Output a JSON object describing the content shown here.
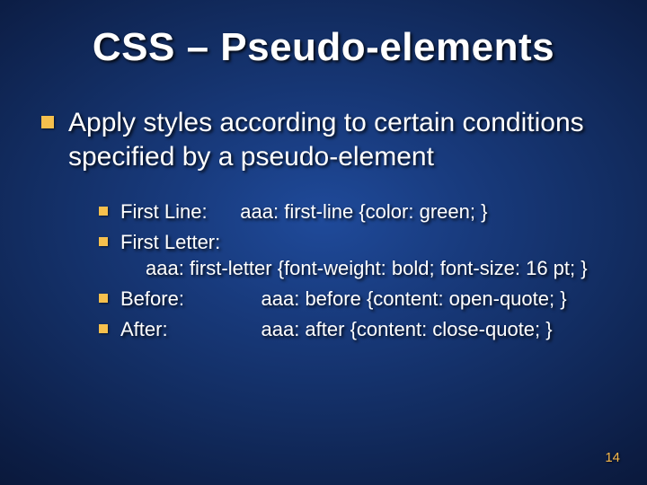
{
  "title": "CSS – Pseudo-elements",
  "main_bullet": "Apply styles according to certain conditions specified by a pseudo-element",
  "sub": [
    {
      "label": "First Line:",
      "code": "aaa: first-line {color: green; }",
      "gap": "      "
    },
    {
      "label": "First Letter:",
      "code": "aaa: first-letter {font-weight: bold; font-size: 16 pt; }",
      "gap": "",
      "wrap": true
    },
    {
      "label": "Before:",
      "code": "aaa: before {content: open-quote; }",
      "gap": "              "
    },
    {
      "label": "After:",
      "code": "aaa: after {content: close-quote; }",
      "gap": "                 "
    }
  ],
  "page_number": "14"
}
